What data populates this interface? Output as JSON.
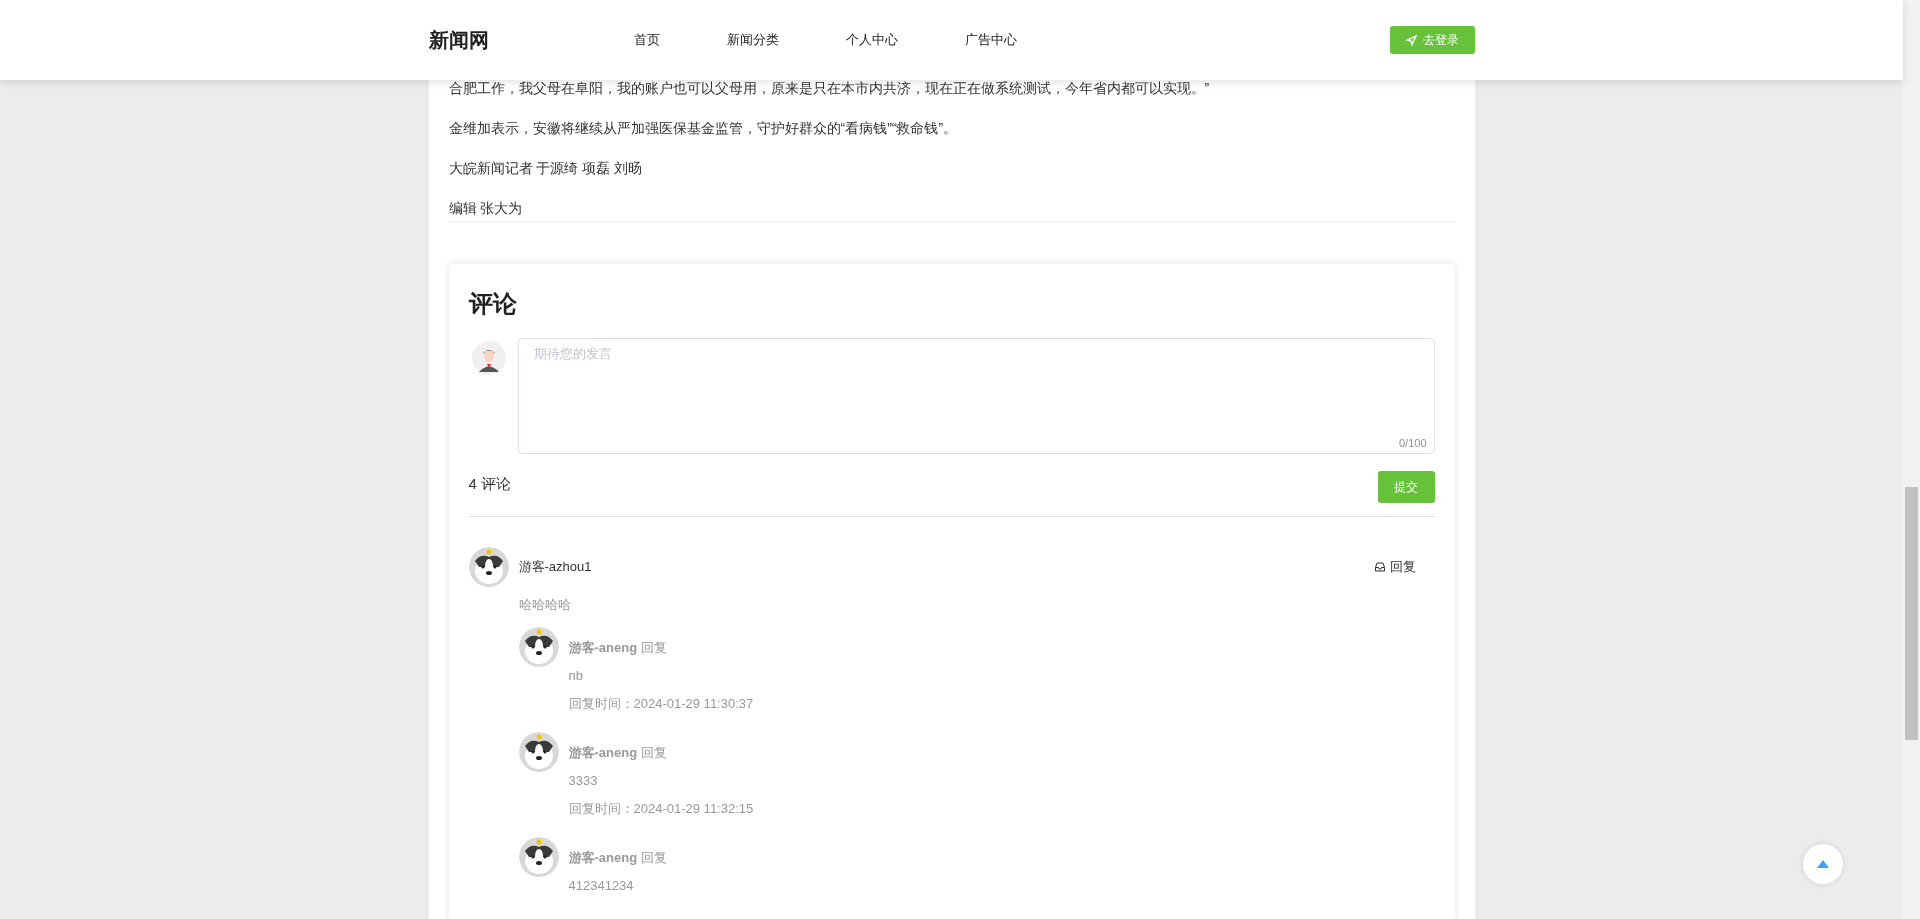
{
  "header": {
    "logo": "新闻网",
    "nav": [
      {
        "label": "首页"
      },
      {
        "label": "新闻分类"
      },
      {
        "label": "个人中心"
      },
      {
        "label": "广告中心"
      }
    ],
    "login_button": "去登录"
  },
  "article": {
    "paragraphs": [
      "合肥工作，我父母在阜阳，我的账户也可以父母用，原来是只在本市内共济，现在正在做系统测试，今年省内都可以实现。”",
      "金维加表示，安徽将继续从严加强医保基金监管，守护好群众的“看病钱”“救命钱”。",
      "大皖新闻记者 于源绮 项磊 刘旸",
      "编辑 张大为"
    ]
  },
  "comments_section": {
    "title": "评论",
    "input": {
      "placeholder": "期待您的发言",
      "counter": "0/100"
    },
    "count": "4 评论",
    "submit_button": "提交",
    "comments": [
      {
        "author": "游客-azhou1",
        "reply_button": "回复",
        "text": "哈哈哈哈",
        "replies": [
          {
            "author": "游客-aneng",
            "action": "回复",
            "text": "nb",
            "time": "回复时间：2024-01-29 11:30:37"
          },
          {
            "author": "游客-aneng",
            "action": "回复",
            "text": "3333",
            "time": "回复时间：2024-01-29 11:32:15"
          },
          {
            "author": "游客-aneng",
            "action": "回复",
            "text": "412341234"
          }
        ]
      }
    ]
  }
}
